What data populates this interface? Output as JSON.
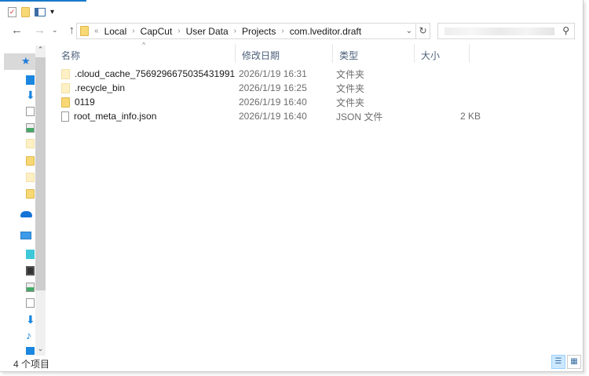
{
  "toolbar": {
    "customize": "▾"
  },
  "address": {
    "overflow": "«",
    "crumbs": [
      "Local",
      "CapCut",
      "User Data",
      "Projects",
      "com.lveditor.draft"
    ]
  },
  "columns": {
    "name": "名称",
    "date": "修改日期",
    "type": "类型",
    "size": "大小"
  },
  "files": [
    {
      "name": ".cloud_cache_7569296675035431991",
      "date": "2026/1/19 16:31",
      "type": "文件夹",
      "size": "",
      "kind": "hidden-folder"
    },
    {
      "name": ".recycle_bin",
      "date": "2026/1/19 16:25",
      "type": "文件夹",
      "size": "",
      "kind": "hidden-folder"
    },
    {
      "name": "0119",
      "date": "2026/1/19 16:40",
      "type": "文件夹",
      "size": "",
      "kind": "folder"
    },
    {
      "name": "root_meta_info.json",
      "date": "2026/1/19 16:40",
      "type": "JSON 文件",
      "size": "2 KB",
      "kind": "file"
    }
  ],
  "status": {
    "count": "4 个项目"
  }
}
